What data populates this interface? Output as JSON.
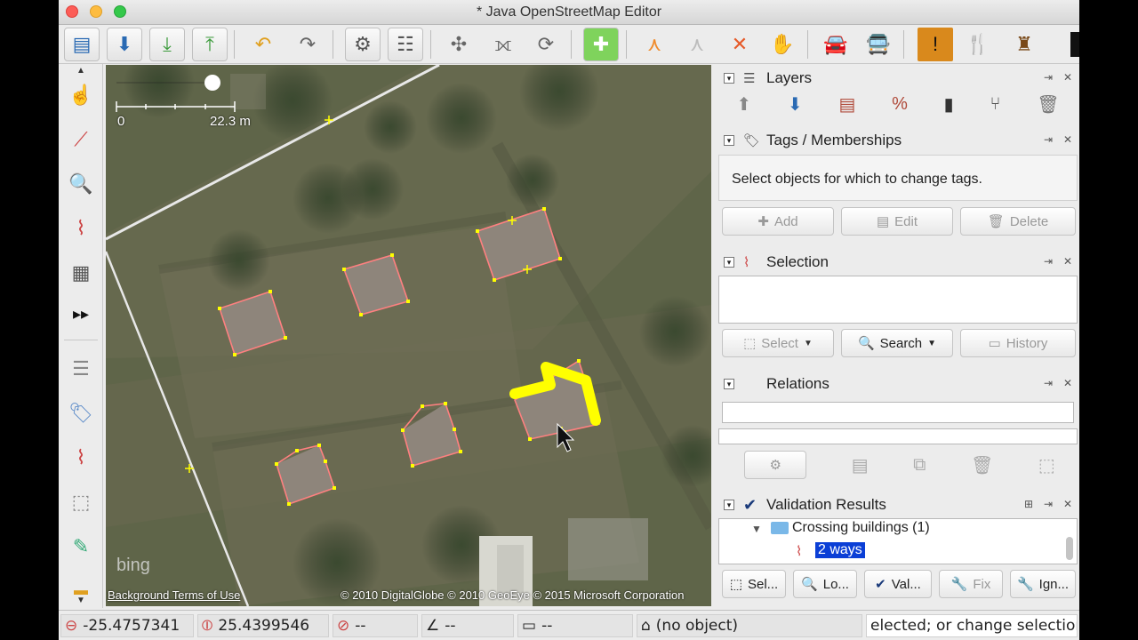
{
  "window": {
    "title": "* Java OpenStreetMap Editor"
  },
  "toolbar": {
    "items": [
      "open-icon",
      "save-icon",
      "download-icon",
      "upload-icon",
      "undo-icon",
      "redo-icon",
      "preferences-icon",
      "filter-icon",
      "simplify-icon",
      "split-icon",
      "refresh-icon",
      "orthogonalize-icon",
      "highway-icon",
      "crossing-icon",
      "crossroads-icon",
      "hand-icon",
      "car-icon",
      "bus-icon",
      "exclamation-icon",
      "restaurant-icon",
      "castle-icon"
    ]
  },
  "map": {
    "scale_start": "0",
    "scale_end": "22.3 m",
    "bing_logo": "bing",
    "background_terms": "Background Terms of Use",
    "copyright": "© 2010 DigitalGlobe © 2010 GeoEye © 2015 Microsoft Corporation"
  },
  "panels": {
    "layers": {
      "title": "Layers"
    },
    "tags": {
      "title": "Tags / Memberships",
      "message": "Select objects for which to change tags.",
      "add_label": "Add",
      "edit_label": "Edit",
      "delete_label": "Delete"
    },
    "selection": {
      "title": "Selection",
      "select_label": "Select",
      "search_label": "Search",
      "history_label": "History"
    },
    "relations": {
      "title": "Relations"
    },
    "validation": {
      "title": "Validation Results",
      "group_label": "Crossing buildings (1)",
      "item_label": "2 ways",
      "buttons": [
        "Sel...",
        "Lo...",
        "Val...",
        "Fix",
        "Ign..."
      ]
    }
  },
  "statusbar": {
    "lat": "-25.4757341",
    "lon": "25.4399546",
    "heading": "--",
    "angle": "--",
    "length": "--",
    "object": "(no object)",
    "help": "elected; or change selection"
  },
  "colors": {
    "accent": "#2a6ab3",
    "highlight": "#0b3fd6",
    "building_outline": "#ff7f7f",
    "selected_way": "#ffff00"
  }
}
